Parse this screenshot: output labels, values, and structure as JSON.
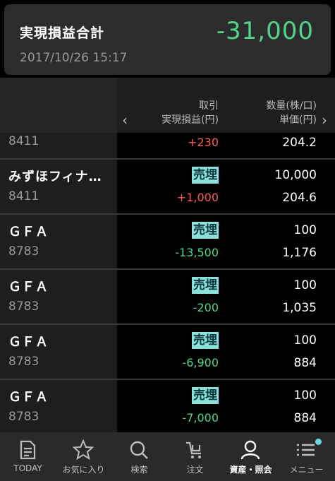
{
  "summary": {
    "label": "実現損益合計",
    "total": "-31,000",
    "datetime": "2017/10/26 15:17"
  },
  "header": {
    "col2_line1": "取引",
    "col2_line2": "実現損益(円)",
    "col3_line1": "数量(株/口)",
    "col3_line2": "単価(円)"
  },
  "rows": [
    {
      "name": "",
      "code": "8411",
      "badge": "",
      "pl": "+230",
      "qty": "",
      "price": "204.2"
    },
    {
      "name": "みずほフィナ…",
      "code": "8411",
      "badge": "売埋",
      "pl": "+1,000",
      "qty": "10,000",
      "price": "204.6"
    },
    {
      "name": "ＧＦＡ",
      "code": "8783",
      "badge": "売埋",
      "pl": "-13,500",
      "qty": "100",
      "price": "1,176"
    },
    {
      "name": "ＧＦＡ",
      "code": "8783",
      "badge": "売埋",
      "pl": "-200",
      "qty": "100",
      "price": "1,035"
    },
    {
      "name": "ＧＦＡ",
      "code": "8783",
      "badge": "売埋",
      "pl": "-6,900",
      "qty": "100",
      "price": "884"
    },
    {
      "name": "ＧＦＡ",
      "code": "8783",
      "badge": "売埋",
      "pl": "-7,000",
      "qty": "100",
      "price": "884"
    }
  ],
  "nav": {
    "today": "TODAY",
    "favorites": "お気に入り",
    "search": "検索",
    "order": "注文",
    "assets": "資産・照会",
    "menu": "メニュー"
  },
  "colors": {
    "accent_green": "#52d48c",
    "accent_red": "#ff5a5a",
    "badge": "#8ee0dc",
    "notification_dot": "#6fd8e0"
  },
  "icons": [
    "document-icon",
    "star-icon",
    "search-icon",
    "cart-icon",
    "person-icon",
    "menu-icon",
    "chevron-left-icon",
    "chevron-right-icon"
  ]
}
